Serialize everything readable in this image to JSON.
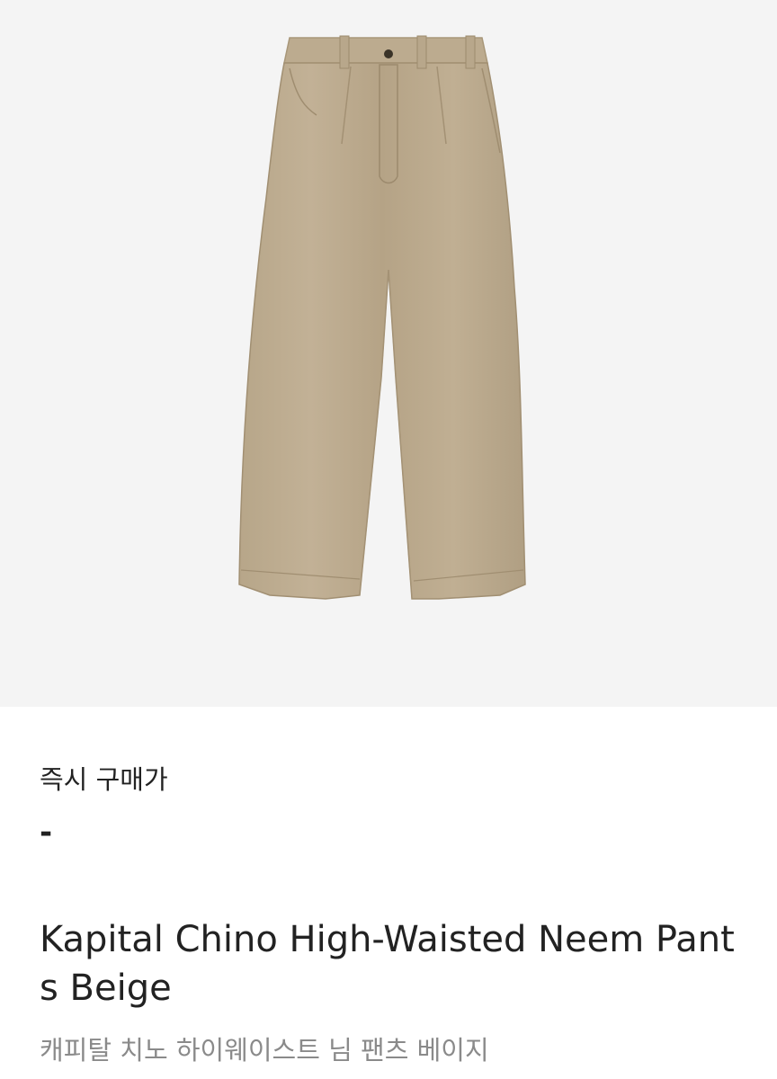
{
  "product": {
    "image_icon": "pants-image",
    "colors": {
      "image_background": "#f4f4f4",
      "pants": "#bfae94",
      "text_primary": "#222222",
      "text_secondary": "#8a8a8a"
    }
  },
  "price": {
    "label": "즉시 구매가",
    "value": "-"
  },
  "title": {
    "english": "Kapital Chino High-Waisted Neem Pants Beige",
    "korean": "캐피탈 치노 하이웨이스트 님 팬츠 베이지"
  }
}
